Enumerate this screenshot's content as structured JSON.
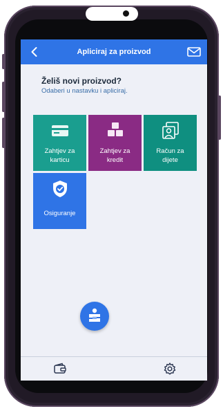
{
  "header": {
    "title": "Apliciraj za proizvod",
    "back_icon": "chevron-left-icon",
    "mail_icon": "envelope-icon"
  },
  "intro": {
    "title": "Želiš novi proizvod?",
    "subtitle": "Odaberi u nastavku i apliciraj."
  },
  "tiles": [
    {
      "label": "Zahtjev za\nkarticu",
      "icon": "credit-card-icon",
      "color": "#1a9e8f"
    },
    {
      "label": "Zahtjev za\nkredit",
      "icon": "cubes-icon",
      "color": "#8a2b84"
    },
    {
      "label": "Račun za\ndijete",
      "icon": "portrait-frames-icon",
      "color": "#0f8f80"
    },
    {
      "label": "Osiguranje",
      "icon": "shield-check-icon",
      "color": "#2f74e6"
    }
  ],
  "bottom_nav": {
    "left_icon": "wallet-icon",
    "center_icon": "bank-logo-icon",
    "right_icon": "gear-icon"
  },
  "colors": {
    "accent": "#2f74e6",
    "background": "#eef0f7"
  }
}
